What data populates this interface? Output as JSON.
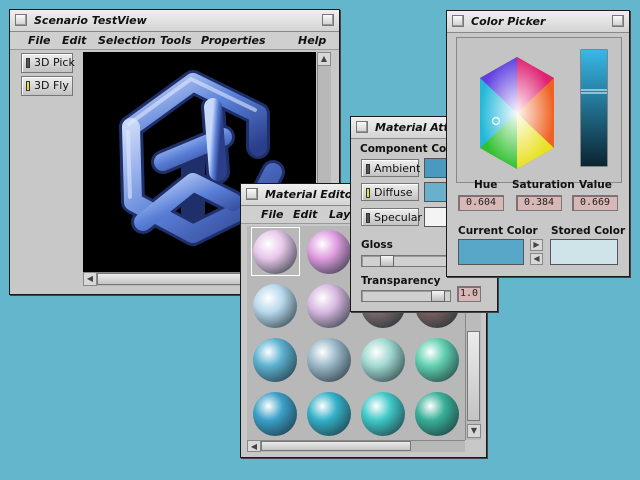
{
  "scenario": {
    "title": "Scenario TestView",
    "menu": [
      "File",
      "Edit",
      "Selection",
      "Tools",
      "Properties",
      "Help"
    ],
    "buttons": [
      {
        "label": "3D Pick",
        "active": false
      },
      {
        "label": "3D Fly",
        "active": true
      }
    ]
  },
  "material_editor": {
    "title": "Material Editor",
    "menu": [
      "File",
      "Edit",
      "Layo"
    ],
    "spheres": [
      [
        "#e8c8ea",
        "#e09de0",
        "#c0a8c8",
        "#a09090"
      ],
      [
        "#b8d8ec",
        "#d8b8e0",
        "#7a6a6a",
        "#7a6060"
      ],
      [
        "#5cb0d0",
        "#9ab8c8",
        "#a0d8d0",
        "#60d0b0"
      ],
      [
        "#3aa0c8",
        "#34b0c8",
        "#40c8c8",
        "#38b098"
      ]
    ]
  },
  "material_attrib": {
    "title": "Material Attribu",
    "component_label": "Component Colo",
    "components": [
      {
        "label": "Ambient",
        "color": "#4a9abf",
        "selected": false
      },
      {
        "label": "Diffuse",
        "color": "#6aafcc",
        "selected": true
      },
      {
        "label": "Specular",
        "color": "#f4f4f4",
        "selected": false
      }
    ],
    "gloss_label": "Gloss",
    "transparency_label": "Transparency",
    "transparency_value": "1.0",
    "gloss_level": 0.24,
    "transparency_level": 0.93
  },
  "color_picker": {
    "title": "Color Picker",
    "hue_label": "Hue",
    "saturation_label": "Saturation",
    "value_label": "Value",
    "hue": "0.604",
    "saturation": "0.384",
    "value": "0.669",
    "current_color_label": "Current Color",
    "stored_color_label": "Stored Color",
    "current_color": "#58a6c8",
    "stored_color": "#cfe4e8"
  }
}
